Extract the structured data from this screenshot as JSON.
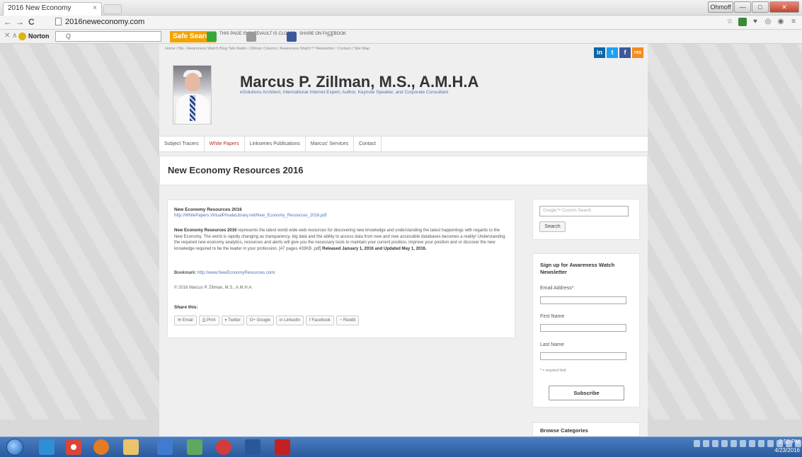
{
  "browser": {
    "tab_title": "2016 New Economy",
    "tab_close": "×",
    "url": "2016neweconomy.com",
    "user_button": "Ohmoff",
    "min_button": "—",
    "max_button": "□",
    "close_button": "✕"
  },
  "norton": {
    "logo": "Norton",
    "search_placeholder": "Q",
    "safe_search": "Safe Search",
    "badges": [
      {
        "label": "THIS PAGE IS SAFE",
        "color": "#3aa63a"
      },
      {
        "label": "VAULT IS CLOSED",
        "color": "#9a9a9a"
      },
      {
        "label": "SHARE ON FACEBOOK",
        "color": "#3b5998"
      }
    ],
    "more": "•••"
  },
  "site": {
    "top_nav": "Home / Bio / Awareness Watch Blog Talk Radio / Zillman Column / Awareness Watch™ Newsletter / Contact / Site Map",
    "social": [
      {
        "label": "in",
        "color": "#0a66a5",
        "name": "linkedin-icon"
      },
      {
        "label": "t",
        "color": "#1da1f2",
        "name": "twitter-icon"
      },
      {
        "label": "f",
        "color": "#3b5998",
        "name": "facebook-icon"
      },
      {
        "label": "rss",
        "color": "#f38b1c",
        "name": "rss-icon"
      }
    ],
    "title": "Marcus P. Zillman, M.S., A.M.H.A",
    "tagline": "eSolutions Architect, International Internet Expert, Author, Keynote Speaker, and Corporate Consultant",
    "menu": [
      {
        "label": "Subject Tracers"
      },
      {
        "label": "White Papers",
        "active": true
      },
      {
        "label": "Linkseries Publications"
      },
      {
        "label": "Marcus' Services"
      },
      {
        "label": "Contact"
      }
    ],
    "page_title": "New Economy Resources 2016"
  },
  "article": {
    "heading": "New Economy Resources 2016",
    "link": "http://WhitePapers.VirtualPrivateLibrary.net/New_Economy_Resources_2016.pdf",
    "body_bold": "New Economy Resources 2016",
    "body_text": " represents the latest world wide web resources for discovering new knowledge and understanding the latest happenings with regards to the New Economy. The world is rapidly changing as transparency, big data and the ability to access data from new and now accessible databases becomes a reality! Understanding the required new economy analytics, resources and alerts will give you the necessary tools to maintain your current position, improve your position and or discover the new knowledge required to be the leader in your profession. [47 pages  433KB .pdf] ",
    "body_released": "Released January 1, 2016 and Updated May 1, 2016.",
    "bookmark_label": "Bookmark:",
    "bookmark_url": "http://www.NewEconomyResources.com/",
    "copyright": "© 2016 Marcus P. Zillman, M.S., A.M.H.A.",
    "share_label": "Share this:",
    "share_buttons": [
      {
        "label": "✉ Email",
        "name": "share-email-button"
      },
      {
        "label": "⎙ Print",
        "name": "share-print-button"
      },
      {
        "label": "Twitter",
        "name": "share-twitter-button"
      },
      {
        "label": "G+ Google",
        "name": "share-google-button"
      },
      {
        "label": "in LinkedIn",
        "name": "share-linkedin-button"
      },
      {
        "label": "f Facebook",
        "name": "share-facebook-button"
      },
      {
        "label": "Reddit",
        "name": "share-reddit-button"
      }
    ]
  },
  "sidebar": {
    "search_placeholder": "Google™ Custom Search",
    "search_button": "Search",
    "newsletter_title": "Sign up for Awareness Watch Newsletter",
    "email_label": "Email Address*",
    "first_name_label": "First Name",
    "last_name_label": "Last Name",
    "required_note": "* = required field",
    "subscribe_button": "Subscribe",
    "categories_title": "Browse Categories"
  },
  "taskbar": {
    "time": "2:50 PM",
    "date": "4/23/2016",
    "apps": [
      {
        "name": "taskbar-ie-icon",
        "color": "#2f8fd6"
      },
      {
        "name": "taskbar-chrome-icon",
        "color": "#d8463a"
      },
      {
        "name": "taskbar-firefox-icon",
        "color": "#e57b22"
      },
      {
        "name": "taskbar-explorer-icon",
        "color": "#e9c46a"
      },
      {
        "name": "taskbar-app-icon",
        "color": "#3f7ccf"
      },
      {
        "name": "taskbar-network-icon",
        "color": "#5fa85f"
      },
      {
        "name": "taskbar-app2-icon",
        "color": "#d33c3c"
      },
      {
        "name": "taskbar-word-icon",
        "color": "#2b579a"
      },
      {
        "name": "taskbar-acrobat-icon",
        "color": "#c3201f"
      }
    ]
  }
}
